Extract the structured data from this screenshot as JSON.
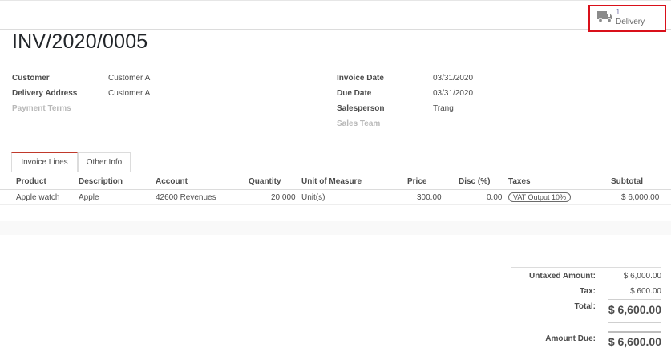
{
  "smart_button": {
    "count": "1",
    "label": "Delivery",
    "icon": "truck-icon"
  },
  "invoice": {
    "number": "INV/2020/0005"
  },
  "fields_left": [
    {
      "label": "Customer",
      "value": "Customer A",
      "muted": false
    },
    {
      "label": "Delivery Address",
      "value": "Customer A",
      "muted": false
    },
    {
      "label": "Payment Terms",
      "value": "",
      "muted": true
    }
  ],
  "fields_right": [
    {
      "label": "Invoice Date",
      "value": "03/31/2020",
      "muted": false
    },
    {
      "label": "Due Date",
      "value": "03/31/2020",
      "muted": false
    },
    {
      "label": "Salesperson",
      "value": "Trang",
      "muted": false
    },
    {
      "label": "Sales Team",
      "value": "",
      "muted": true
    }
  ],
  "tabs": [
    {
      "label": "Invoice Lines",
      "active": true
    },
    {
      "label": "Other Info",
      "active": false
    }
  ],
  "table": {
    "columns": [
      "Product",
      "Description",
      "Account",
      "Quantity",
      "Unit of Measure",
      "Price",
      "Disc (%)",
      "Taxes",
      "Subtotal"
    ],
    "rows": [
      {
        "product": "Apple watch",
        "description": "Apple",
        "account": "42600 Revenues",
        "quantity": "20.000",
        "uom": "Unit(s)",
        "price": "300.00",
        "disc": "0.00",
        "taxes": "VAT Output 10%",
        "subtotal": "$ 6,000.00"
      }
    ]
  },
  "totals": {
    "untaxed_label": "Untaxed Amount:",
    "untaxed_value": "$ 6,000.00",
    "tax_label": "Tax:",
    "tax_value": "$ 600.00",
    "total_label": "Total:",
    "total_value": "$ 6,600.00",
    "due_label": "Amount Due:",
    "due_value": "$ 6,600.00"
  },
  "colors": {
    "highlight": "#d9101a",
    "tab_accent": "#c0392b",
    "smart_count": "#7c7bad"
  }
}
